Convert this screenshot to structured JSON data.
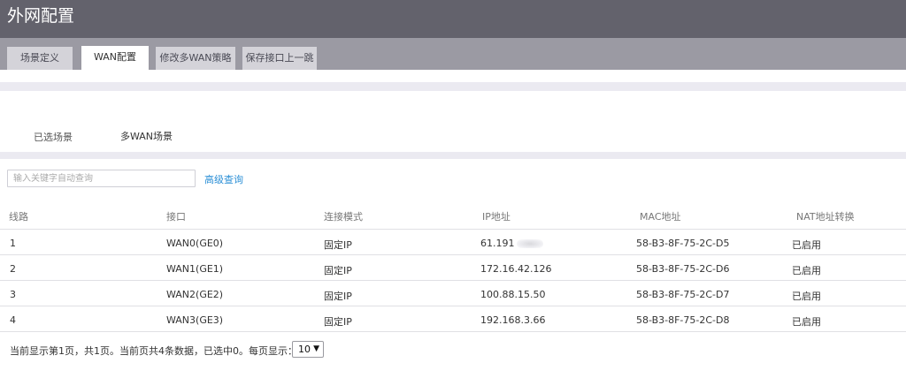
{
  "header": {
    "title": "外网配置"
  },
  "tabs": [
    {
      "label": "场景定义"
    },
    {
      "label": "WAN配置"
    },
    {
      "label": "修改多WAN策略"
    },
    {
      "label": "保存接口上一跳"
    }
  ],
  "scene": {
    "label": "已选场景",
    "value": "多WAN场景"
  },
  "search": {
    "placeholder": "输入关键字自动查询",
    "value": "",
    "advanced_label": "高级查询"
  },
  "table": {
    "headers": [
      "线路",
      "接口",
      "连接模式",
      "IP地址",
      "MAC地址",
      "NAT地址转换"
    ],
    "rows": [
      {
        "line": "1",
        "iface": "WAN0(GE0)",
        "mode": "固定IP",
        "ip": "61.191",
        "mac": "58-B3-8F-75-2C-D5",
        "nat": "已启用"
      },
      {
        "line": "2",
        "iface": "WAN1(GE1)",
        "mode": "固定IP",
        "ip": "172.16.42.126",
        "mac": "58-B3-8F-75-2C-D6",
        "nat": "已启用"
      },
      {
        "line": "3",
        "iface": "WAN2(GE2)",
        "mode": "固定IP",
        "ip": "100.88.15.50",
        "mac": "58-B3-8F-75-2C-D7",
        "nat": "已启用"
      },
      {
        "line": "4",
        "iface": "WAN3(GE3)",
        "mode": "固定IP",
        "ip": "192.168.3.66",
        "mac": "58-B3-8F-75-2C-D8",
        "nat": "已启用"
      }
    ]
  },
  "pager": {
    "summary": "当前显示第1页，共1页。当前页共4条数据，已选中0。每页显示：",
    "page_size": "10",
    "dropdown_icon": "chevron-down-icon"
  }
}
